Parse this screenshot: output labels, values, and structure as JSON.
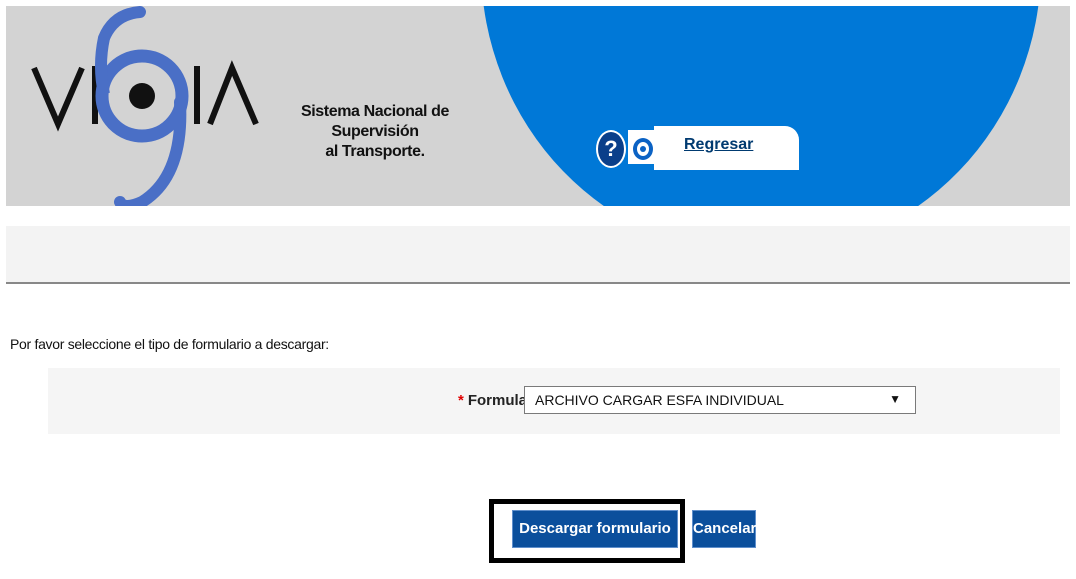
{
  "header": {
    "logo_text": "VIGIA",
    "subtitle_line1": "Sistema Nacional de Supervisión",
    "subtitle_line2": "al Transporte.",
    "back_link_label": "Regresar",
    "help_icon_glyph": "?",
    "icons": [
      "help-icon",
      "back-icon"
    ]
  },
  "form": {
    "instruction": "Por favor seleccione el tipo de formulario a descargar:",
    "required_marker": "*",
    "field_label": "Formulario:",
    "selected_value": "ARCHIVO CARGAR ESFA INDIVIDUAL",
    "dropdown_arrow": "▼",
    "download_button": "Descargar formulario",
    "cancel_button": "Cancelar"
  },
  "colors": {
    "brand_blue": "#0078d7",
    "button_blue": "#0b4f9c",
    "header_gray": "#d3d3d3",
    "required_red": "#e00000"
  }
}
